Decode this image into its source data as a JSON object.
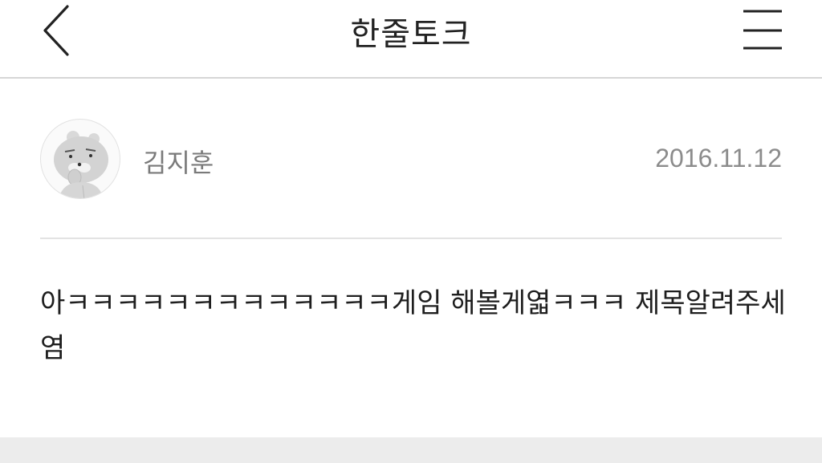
{
  "header": {
    "title": "한줄토크",
    "back_icon": "chevron-left-icon",
    "menu_icon": "hamburger-menu-icon"
  },
  "post": {
    "author": "김지훈",
    "avatar_icon": "ryan-character-avatar-icon",
    "date": "2016.11.12",
    "content": "아ㅋㅋㅋㅋㅋㅋㅋㅋㅋㅋㅋㅋㅋ게임 해볼게엷ㅋㅋㅋ 제목알려주세염"
  },
  "colors": {
    "divider": "#d6d6d6",
    "muted_text": "#7a7a7a",
    "bottom_band": "#ececec"
  }
}
